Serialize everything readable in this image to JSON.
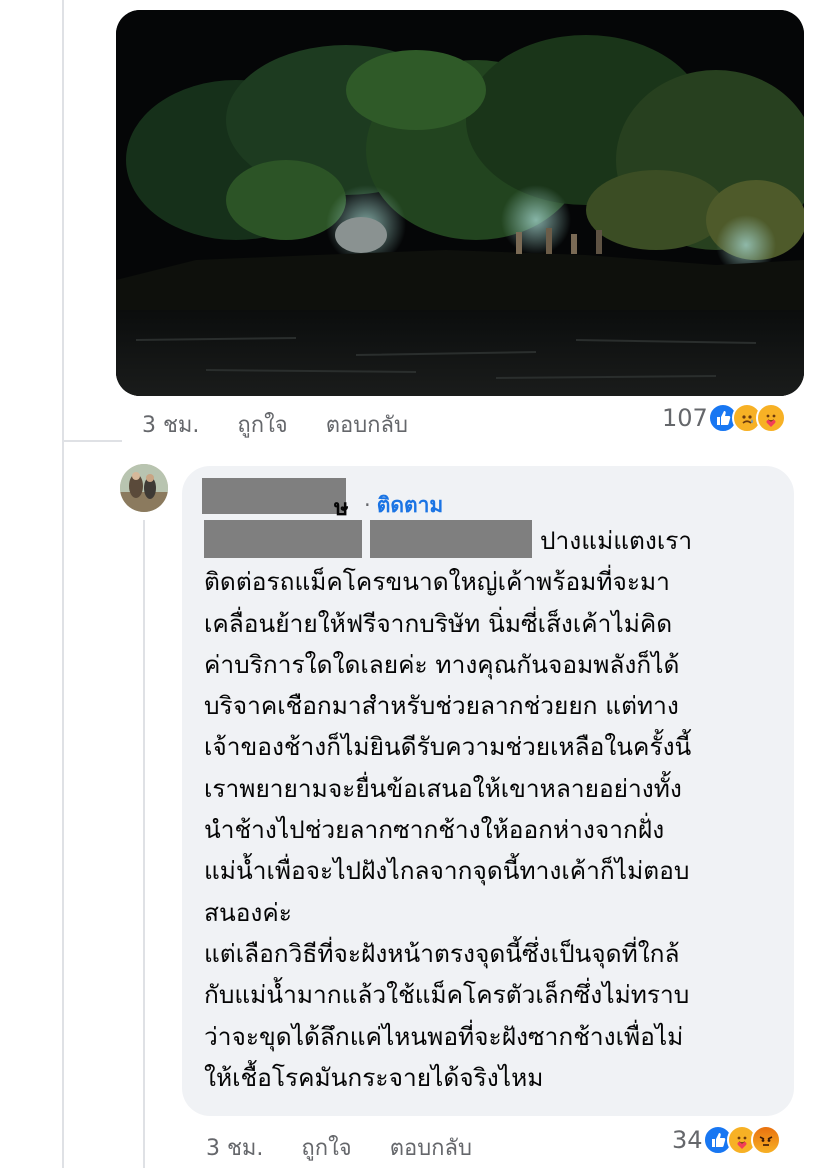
{
  "first_comment": {
    "photo_description_icon": "night-river-photo",
    "time": "3 ชม.",
    "like_label": "ถูกใจ",
    "reply_label": "ตอบกลับ",
    "reaction_count": "107",
    "reaction_icons": [
      "like-icon",
      "sad-icon",
      "care-icon"
    ]
  },
  "second_comment": {
    "author_suffix": "ษ",
    "follow_separator": "·",
    "follow_label": "ติดตาม",
    "text": "ปางแม่แตงเรา\nติดต่อรถแม็คโครขนาดใหญ่เค้าพร้อมที่จะมา\nเคลื่อนย้ายให้ฟรีจากบริษัท นิ่มซี่เส็งเค้าไม่คิด\nค่าบริการใดใดเลยค่ะ ทางคุณกันจอมพลังก็ได้\nบริจาคเชือกมาสำหรับช่วยลากช่วยยก แต่ทาง\nเจ้าของช้างก็ไม่ยินดีรับความช่วยเหลือในครั้งนี้\nเราพยายามจะยื่นข้อเสนอให้เขาหลายอย่างทั้ง\nนำช้างไปช่วยลากซากช้างให้ออกห่างจากฝั่ง\nแม่น้ำเพื่อจะไปฝังไกลจากจุดนี้ทางเค้าก็ไม่ตอบ\nสนองค่ะ\nแต่เลือกวิธีที่จะฝังหน้าตรงจุดนี้ซึ่งเป็นจุดที่ใกล้\nกับแม่น้ำมากแล้วใช้แม็คโครตัวเล็กซึ่งไม่ทราบ\nว่าจะขุดได้ลึกแค่ไหนพอที่จะฝังซากช้างเพื่อไม่\nให้เชื้อโรคมันกระจายได้จริงไหม",
    "time": "3 ชม.",
    "like_label": "ถูกใจ",
    "reply_label": "ตอบกลับ",
    "reaction_count": "34",
    "reaction_icons": [
      "like-icon",
      "care-icon",
      "angry-icon"
    ]
  },
  "colors": {
    "link_blue": "#1b74e4",
    "meta_gray": "#65676b",
    "bubble_bg": "#f0f2f5",
    "redaction": "#7f7f7f"
  }
}
